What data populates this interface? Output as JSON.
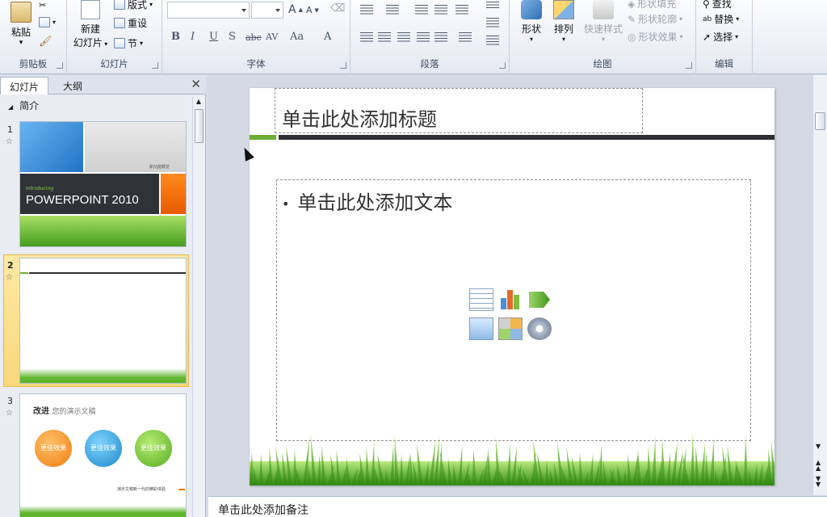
{
  "ribbon": {
    "clipboard": {
      "paste": "粘贴",
      "label": "剪贴板"
    },
    "slides": {
      "new_slide": "新建",
      "new_slide_2": "幻灯片",
      "layout": "版式",
      "reset": "重设",
      "section": "节",
      "label": "幻灯片"
    },
    "font": {
      "label": "字体",
      "bold": "B",
      "italic": "I",
      "underline": "U",
      "shadow": "S",
      "strike": "abc",
      "spacing": "AV",
      "case": "Aa",
      "color": "A",
      "grow": "A",
      "shrink": "A"
    },
    "paragraph": {
      "label": "段落"
    },
    "drawing": {
      "shapes": "形状",
      "arrange": "排列",
      "quick_styles": "快速样式",
      "shape_fill": "形状填充",
      "shape_outline": "形状轮廓",
      "shape_effects": "形状效果",
      "label": "绘图"
    },
    "editing": {
      "find": "查找",
      "replace": "替换",
      "select": "选择",
      "label": "编辑"
    }
  },
  "left_pane": {
    "tabs": [
      "幻灯片",
      "大纲"
    ],
    "section_name": "简介",
    "slides": [
      {
        "number": "1",
        "intro": "Introducing",
        "title": "POWERPOINT 2010",
        "tag": "新功能概览"
      },
      {
        "number": "2"
      },
      {
        "number": "3",
        "heading": "改进",
        "subheading": "您的演示文稿",
        "bubbles": [
          "更佳效果",
          "更佳效果",
          "更佳效果"
        ],
        "footer": "演示文稿新一代的精彩体验"
      }
    ]
  },
  "slide": {
    "title_placeholder": "单击此处添加标题",
    "body_placeholder": "单击此处添加文本",
    "bullet": "•"
  },
  "notes_placeholder": "单击此处添加备注",
  "colors": {
    "accent_green": "#6cae34",
    "dark_rule": "#2d2f33",
    "selection": "#f8d77a"
  }
}
